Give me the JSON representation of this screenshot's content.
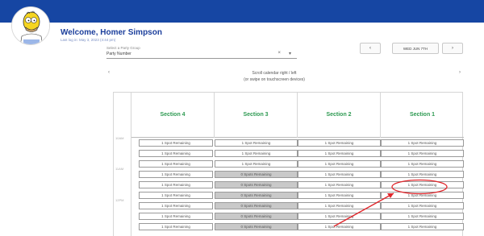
{
  "header": {
    "welcome": "Welcome, Homer Simpson",
    "login_info": "Last log in: May 3, 2023 (4:44 pm)"
  },
  "party_select": {
    "label": "Select a Party Group",
    "value": "Party Number",
    "clear_icon": "×",
    "arrow_icon": "▾"
  },
  "date_nav": {
    "prev_label": "‹",
    "date_label": "WED JUN 7TH",
    "next_label": "›"
  },
  "scroll": {
    "left_icon": "‹",
    "right_icon": "›",
    "hint_line1": "Scroll calendar right / left",
    "hint_line2": "(or swipe on touchscreen devices)"
  },
  "sections": [
    "Section 4",
    "Section 3",
    "Section 2",
    "Section 1"
  ],
  "time_labels": [
    "10AM",
    "11AM",
    "12PM"
  ],
  "rows": [
    [
      "1 Spot Remaining",
      "1 Spot Remaining",
      "1 Spot Remaining",
      "1 Spot Remaining"
    ],
    [
      "1 Spot Remaining",
      "1 Spot Remaining",
      "1 Spot Remaining",
      "1 Spot Remaining"
    ],
    [
      "1 Spot Remaining",
      "1 Spot Remaining",
      "1 Spot Remaining",
      "1 Spot Remaining"
    ],
    [
      "1 Spot Remaining",
      "0 Spots Remaining",
      "1 Spot Remaining",
      "1 Spot Remaining"
    ],
    [
      "1 Spot Remaining",
      "0 Spots Remaining",
      "1 Spot Remaining",
      "1 Spot Remaining"
    ],
    [
      "1 Spot Remaining",
      "0 Spots Remaining",
      "1 Spot Remaining",
      "1 Spot Remaining"
    ],
    [
      "1 Spot Remaining",
      "0 Spots Remaining",
      "1 Spot Remaining",
      "1 Spot Remaining"
    ],
    [
      "1 Spot Remaining",
      "0 Spots Remaining",
      "1 Spot Remaining",
      "1 Spot Remaining"
    ],
    [
      "1 Spot Remaining",
      "0 Spots Remaining",
      "1 Spot Remaining",
      "1 Spot Remaining"
    ]
  ],
  "unavailable_cells": [
    [
      3,
      1
    ],
    [
      4,
      1
    ],
    [
      5,
      1
    ],
    [
      6,
      1
    ],
    [
      7,
      1
    ],
    [
      8,
      1
    ]
  ],
  "colors": {
    "topbar": "#1646a3",
    "section_header": "#2e9a52",
    "unavailable_slot": "#c9c9c9",
    "annotation": "#e0262b"
  },
  "avatar_icon": "homer-simpson-avatar"
}
